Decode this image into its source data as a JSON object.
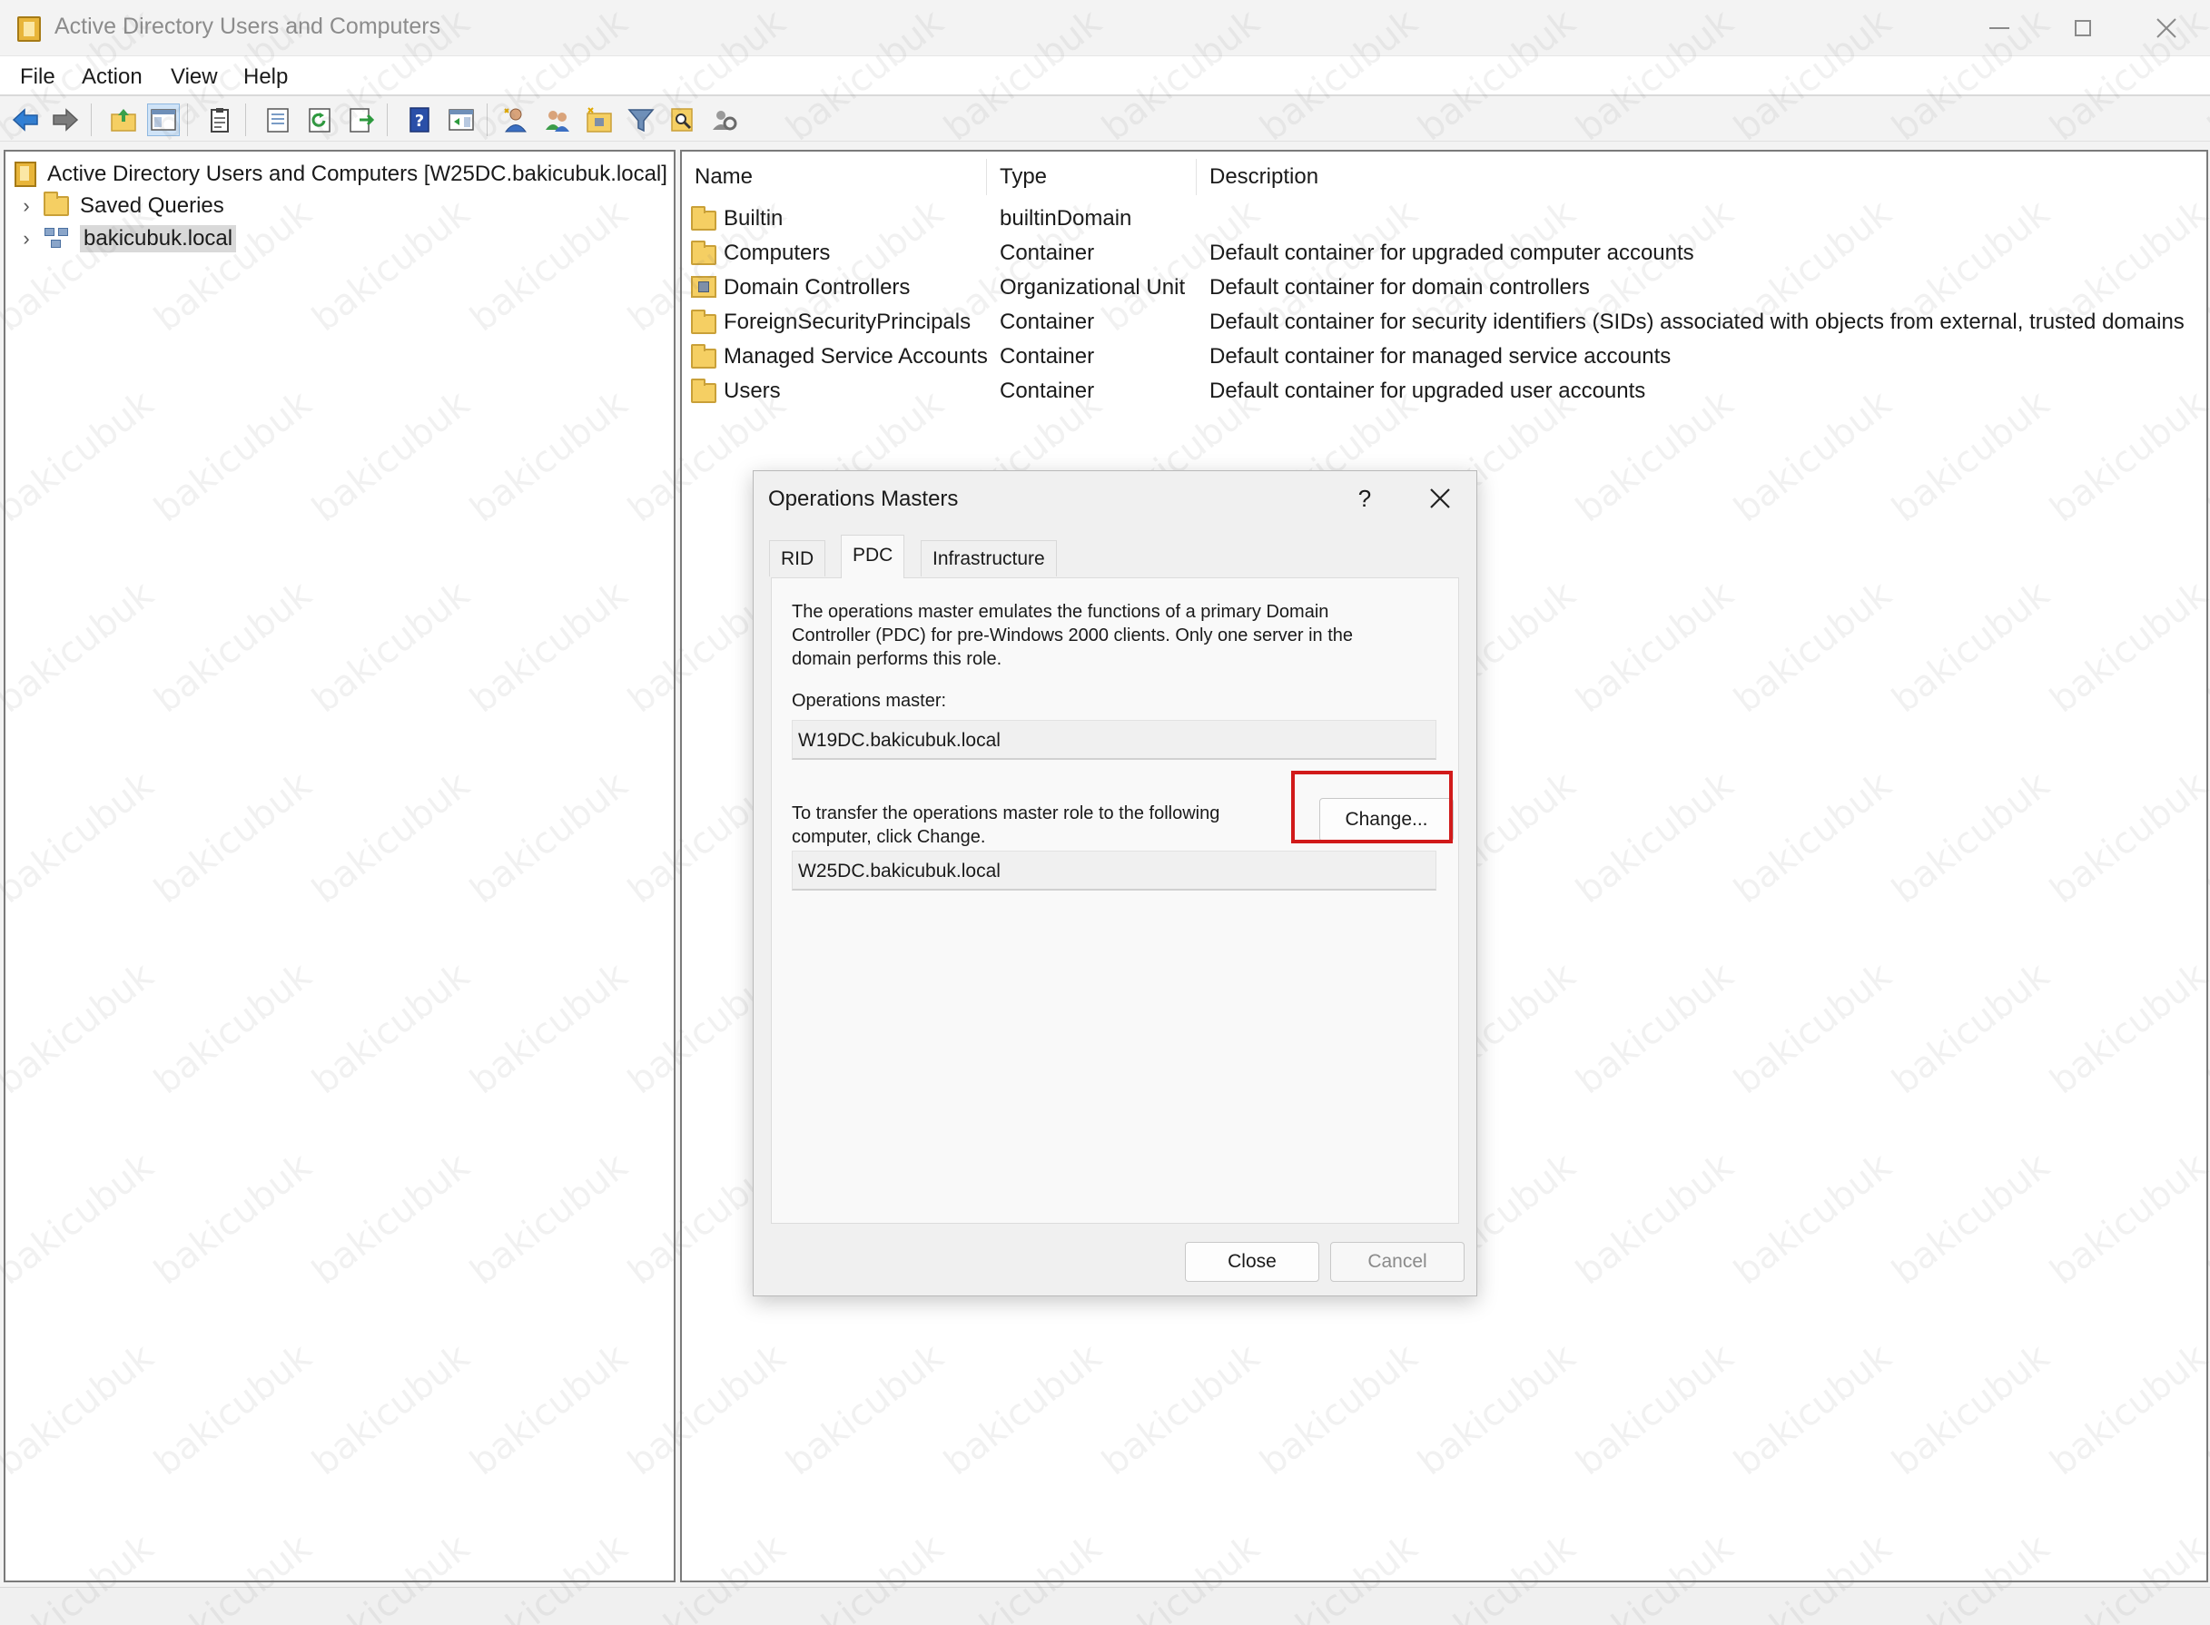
{
  "window": {
    "title": "Active Directory Users and Computers",
    "icon": "aduc-book-icon"
  },
  "menu": [
    "File",
    "Action",
    "View",
    "Help"
  ],
  "toolbar": {
    "icons": [
      "back-arrow-icon",
      "forward-arrow-icon",
      "up-folder-icon",
      "show-console-tree-icon",
      "properties-clipboard-icon",
      "export-list-icon",
      "refresh-icon",
      "export-icon",
      "help-icon",
      "show-action-pane-icon",
      "new-user-icon",
      "new-group-icon",
      "new-ou-icon",
      "filter-icon",
      "find-icon",
      "delegate-icon"
    ]
  },
  "tree": {
    "root": "Active Directory Users and Computers [W25DC.bakicubuk.local]",
    "items": [
      {
        "label": "Saved Queries",
        "icon": "folder-icon"
      },
      {
        "label": "bakicubuk.local",
        "icon": "domain-icon",
        "selected": true
      }
    ]
  },
  "list": {
    "columns": [
      "Name",
      "Type",
      "Description"
    ],
    "rows": [
      {
        "name": "Builtin",
        "type": "builtinDomain",
        "description": "",
        "icon": "folder-icon"
      },
      {
        "name": "Computers",
        "type": "Container",
        "description": "Default container for upgraded computer accounts",
        "icon": "folder-icon"
      },
      {
        "name": "Domain Controllers",
        "type": "Organizational Unit",
        "description": "Default container for domain controllers",
        "icon": "ou-icon"
      },
      {
        "name": "ForeignSecurityPrincipals",
        "type": "Container",
        "description": "Default container for security identifiers (SIDs) associated with objects from external, trusted domains",
        "icon": "folder-icon"
      },
      {
        "name": "Managed Service Accounts",
        "type": "Container",
        "description": "Default container for managed service accounts",
        "icon": "folder-icon"
      },
      {
        "name": "Users",
        "type": "Container",
        "description": "Default container for upgraded user accounts",
        "icon": "folder-icon"
      }
    ]
  },
  "dialog": {
    "title": "Operations Masters",
    "help": "?",
    "tabs": [
      "RID",
      "PDC",
      "Infrastructure"
    ],
    "active_tab": "PDC",
    "description_line1": "The operations master emulates the functions of a primary Domain",
    "description_line2": "Controller (PDC) for pre-Windows 2000 clients. Only one server in the",
    "description_line3": "domain performs this role.",
    "master_label": "Operations master:",
    "master_value": "W19DC.bakicubuk.local",
    "transfer_line1": "To transfer the operations master role to the following",
    "transfer_line2": "computer, click Change.",
    "change_button": "Change...",
    "target_value": "W25DC.bakicubuk.local",
    "close_button": "Close",
    "cancel_button": "Cancel",
    "highlight_color": "#d11a1a"
  },
  "watermark": "bakicubuk"
}
